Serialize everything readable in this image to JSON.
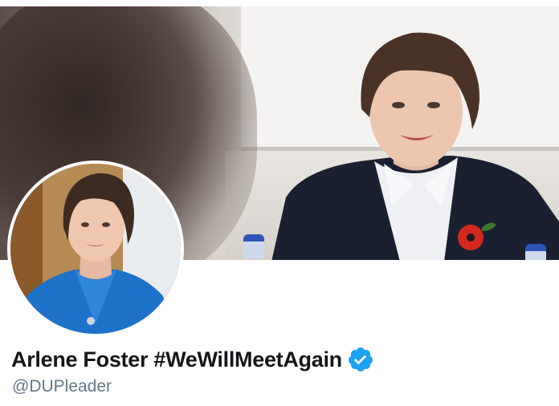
{
  "profile": {
    "display_name": "Arlene Foster #WeWillMeetAgain",
    "handle": "@DUPleader",
    "verified": true,
    "verified_badge_icon": "verified-badge-icon",
    "colors": {
      "name": "#14171a",
      "handle": "#657786",
      "verified_badge": "#1da1f2"
    }
  },
  "banner": {
    "image": "header-photo"
  },
  "avatar": {
    "image": "profile-photo"
  }
}
